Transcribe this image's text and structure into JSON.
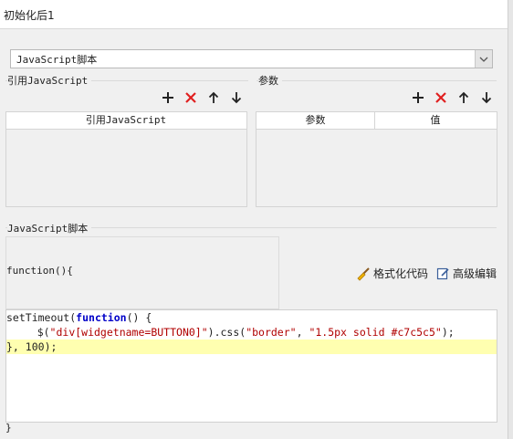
{
  "window": {
    "title": "初始化后1"
  },
  "script_type": {
    "selected": "JavaScript脚本"
  },
  "ref_js": {
    "label": "引用JavaScript",
    "column": "引用JavaScript"
  },
  "params": {
    "label": "参数",
    "columns": [
      "参数",
      "值"
    ]
  },
  "script": {
    "label": "JavaScript脚本",
    "header": "function(){",
    "format_label": "格式化代码",
    "advanced_label": "高级编辑",
    "footer": "}"
  },
  "code": {
    "line1a": "setTimeout(",
    "line1b": "function",
    "line1c": "() {",
    "line2a": "    $(",
    "line2b": "\"div[widgetname=BUTTON0]\"",
    "line2c": ").css(",
    "line2d": "\"border\"",
    "line2e": ", ",
    "line2f": "\"1.5px solid #c7c5c5\"",
    "line2g": ");",
    "line3a": "}, ",
    "line3b": "100",
    "line3c": ");"
  },
  "colors": {
    "add": "#222222",
    "delete": "#e02020",
    "keyword": "#0000c8",
    "string": "#b00000",
    "highlight": "#ffffb0"
  }
}
